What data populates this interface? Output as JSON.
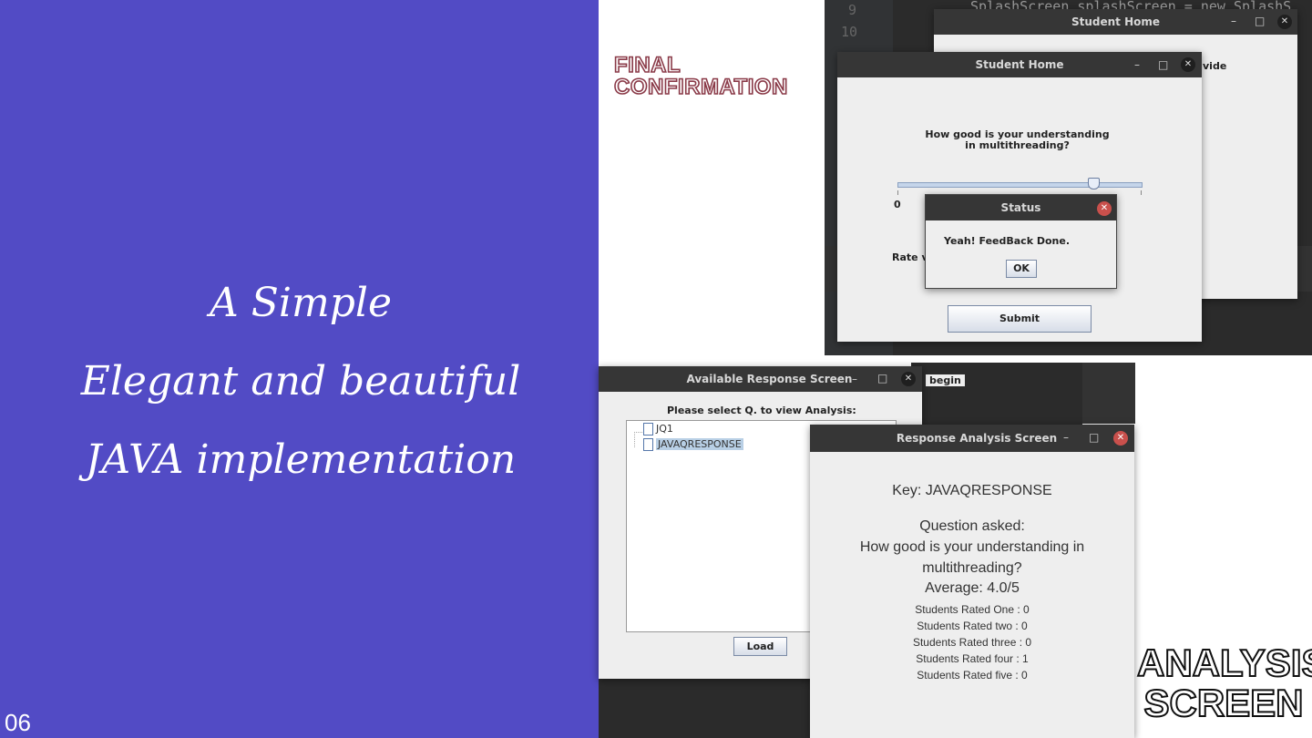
{
  "left": {
    "tagline": [
      "A Simple",
      "Elegant and beautiful",
      "JAVA implementation"
    ],
    "slide_number": "06"
  },
  "labels": {
    "final_confirmation": [
      "FINAL",
      "CONFIRMATION"
    ],
    "analysis_screen": [
      "ANALYSIS",
      "SCREEN"
    ]
  },
  "editor": {
    "line_numbers": [
      "9",
      "10"
    ],
    "code_snippet": "SplashScreen splashScreen = new SplashS",
    "partial_text": "vide",
    "partial_begin": "begin"
  },
  "student_home_back": {
    "title": "Student Home"
  },
  "student_home": {
    "title": "Student Home",
    "question": "How good is your understanding in multithreading?",
    "slider_min": "0",
    "slider_value": 0.8,
    "rate_label": "Rate v",
    "submit_label": "Submit"
  },
  "status_dialog": {
    "title": "Status",
    "message": "Yeah! FeedBack Done.",
    "ok_label": "OK"
  },
  "available_response": {
    "title": "Available Response Screen",
    "prompt": "Please select Q. to view Analysis:",
    "items": [
      "JQ1",
      "JAVAQRESPONSE"
    ],
    "selected_index": 1,
    "load_label": "Load"
  },
  "response_analysis": {
    "title": "Response Analysis Screen",
    "key": "Key: JAVAQRESPONSE",
    "question_heading": "Question asked:",
    "question_line1": "How good is your understanding in",
    "question_line2": "multithreading?",
    "average": "Average: 4.0/5",
    "counts": [
      "Students Rated One : 0",
      "Students Rated two : 0",
      "Students Rated three : 0",
      "Students Rated four : 1",
      "Students Rated five : 0"
    ]
  },
  "colors": {
    "left_bg": "#524bc5",
    "titlebar": "#363636",
    "selection": "#b8cfe5",
    "label_outline": "#8a3a48"
  }
}
